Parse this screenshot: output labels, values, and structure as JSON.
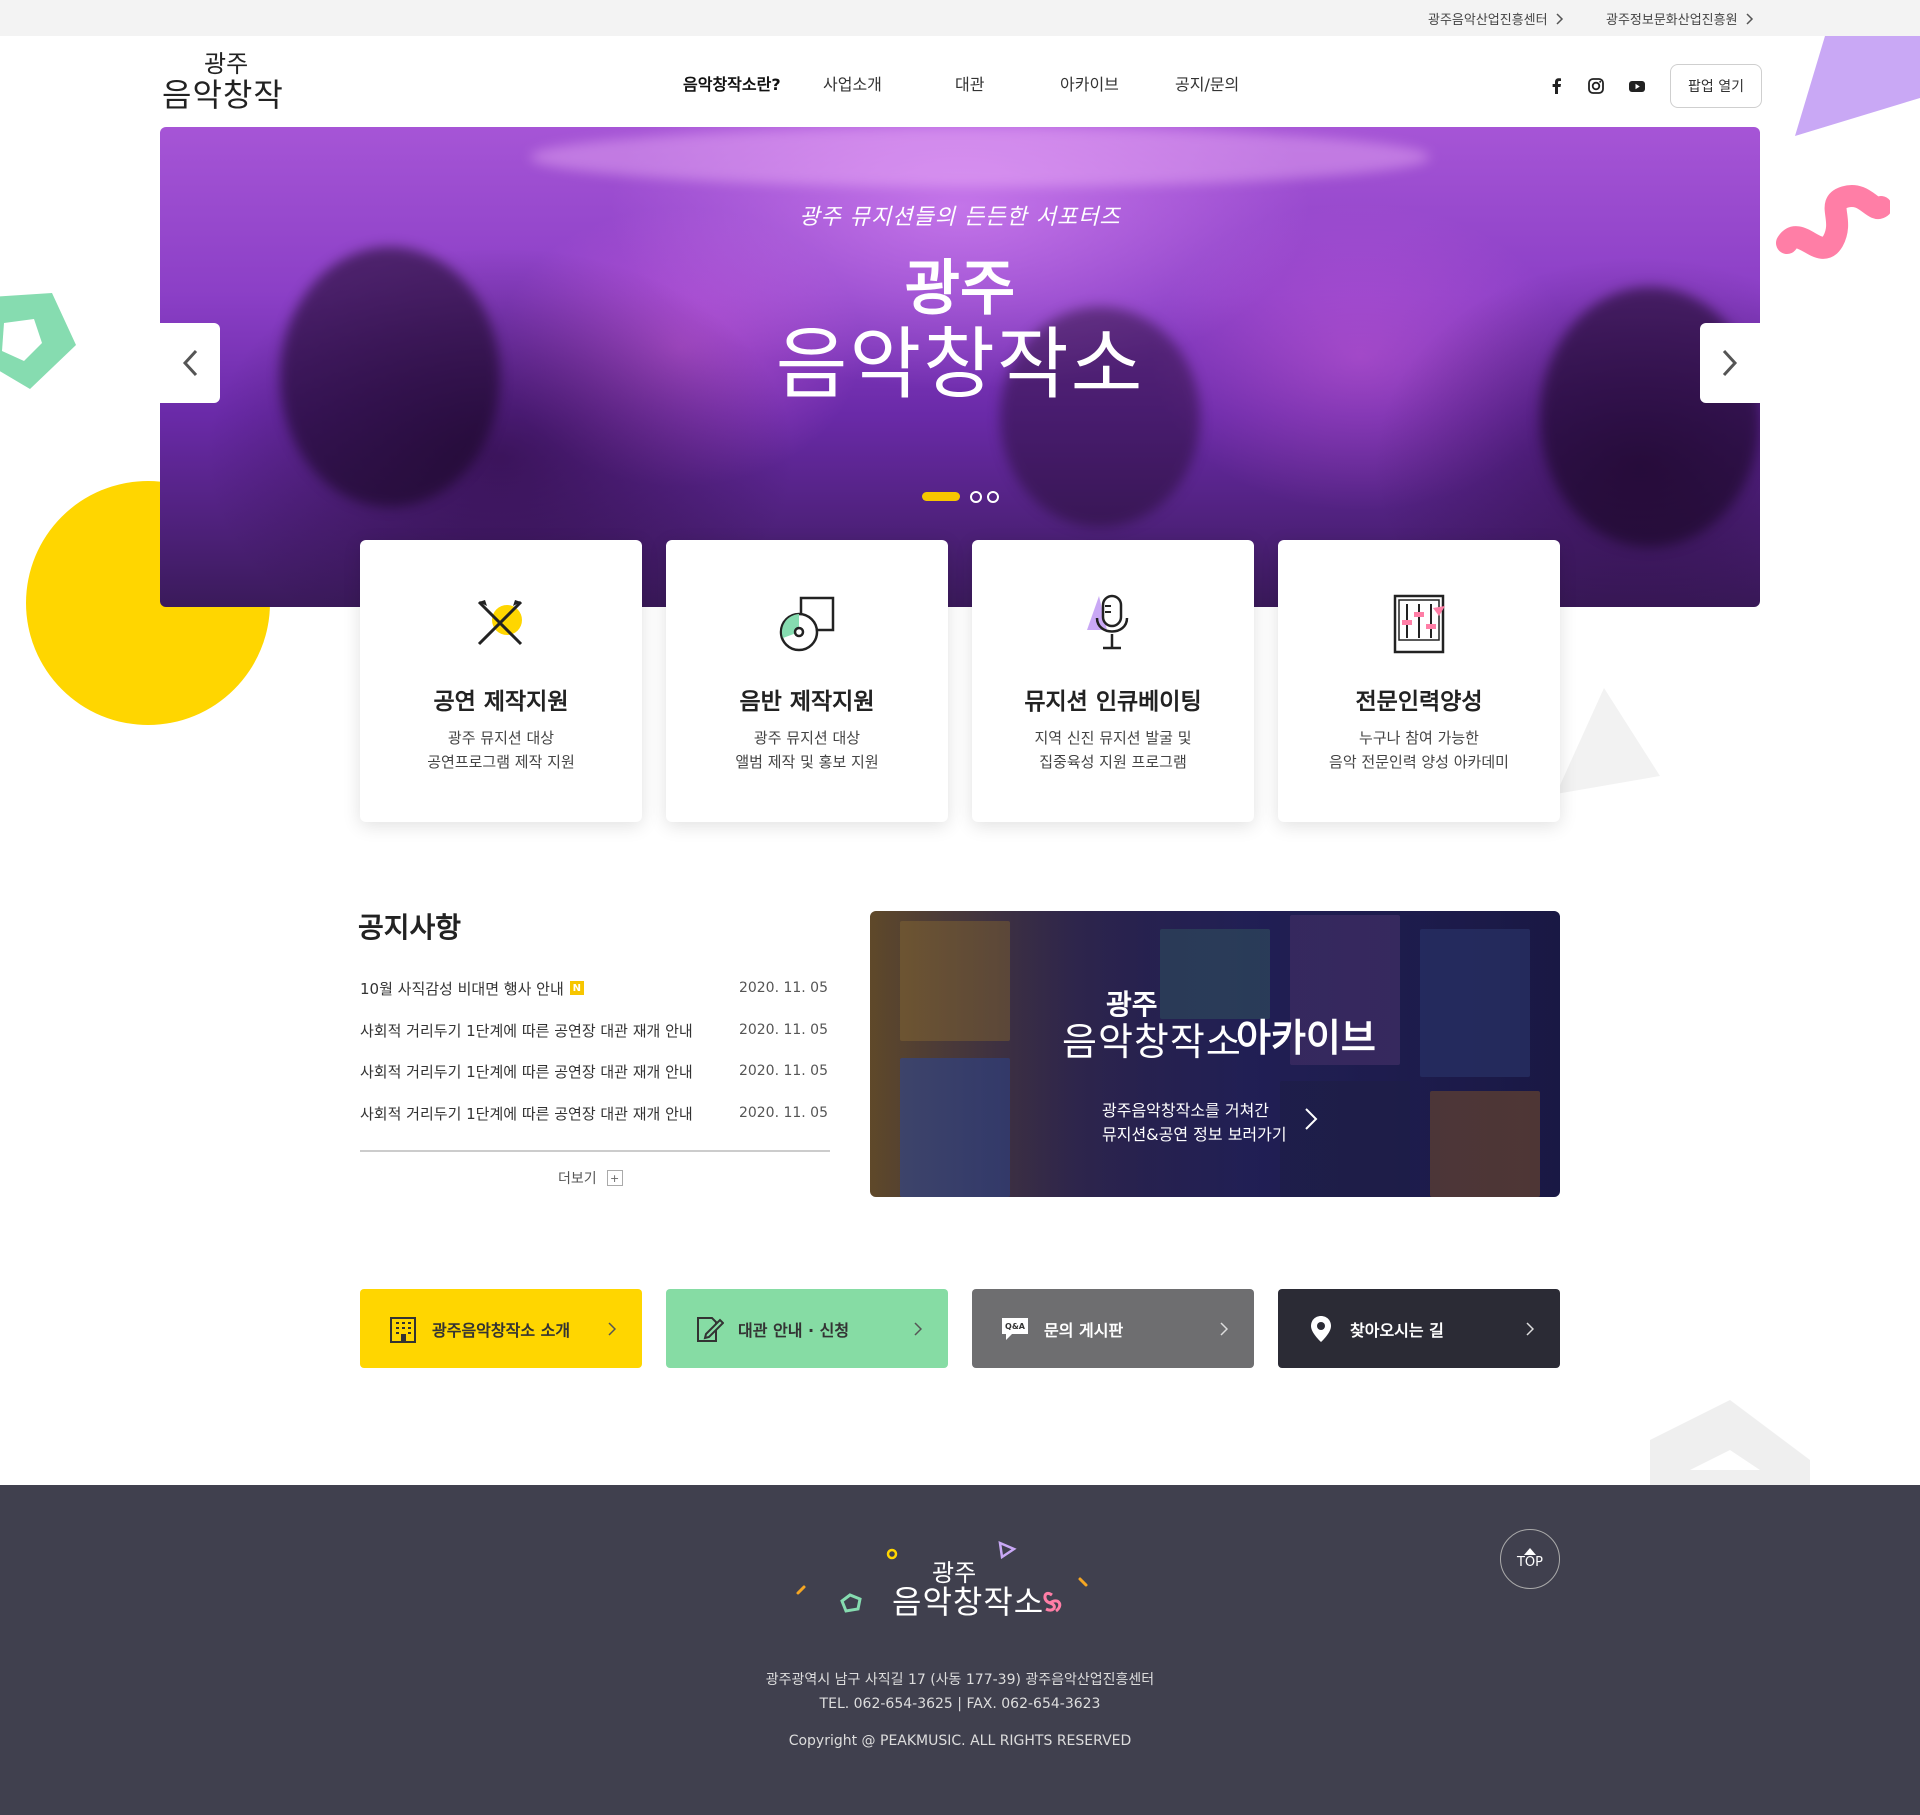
{
  "util_links": [
    "광주음악산업진흥센터",
    "광주정보문화산업진흥원"
  ],
  "logo": {
    "line1": "광주",
    "line2": "음악창작소"
  },
  "nav": [
    "음악창작소란?",
    "사업소개",
    "대관",
    "아카이브",
    "공지/문의"
  ],
  "social_icons": [
    "facebook-icon",
    "instagram-icon",
    "youtube-icon"
  ],
  "popup_button": "팝업 열기",
  "hero": {
    "subtitle": "광주 뮤지션들의 든든한 서포터즈",
    "title_line1": "광주",
    "title_line2": "음악창작소",
    "slide_index": 1,
    "slide_count": 3
  },
  "services": [
    {
      "title": "공연 제작지원",
      "desc1": "광주 뮤지션 대상",
      "desc2": "공연프로그램 제작 지원",
      "icon": "performance-icon"
    },
    {
      "title": "음반 제작지원",
      "desc1": "광주 뮤지션 대상",
      "desc2": "앨범 제작 및 홍보 지원",
      "icon": "album-icon"
    },
    {
      "title": "뮤지션 인큐베이팅",
      "desc1": "지역 신진 뮤지션 발굴 및",
      "desc2": "집중육성 지원 프로그램",
      "icon": "microphone-icon"
    },
    {
      "title": "전문인력양성",
      "desc1": "누구나 참여 가능한",
      "desc2": "음악 전문인력 양성 아카데미",
      "icon": "mixer-icon"
    }
  ],
  "notice": {
    "title": "공지사항",
    "items": [
      {
        "text": "10월 사직감성 비대면 행사 안내",
        "date": "2020. 11. 05",
        "new": "N"
      },
      {
        "text": "사회적 거리두기 1단계에 따른 공연장 대관 재개 안내",
        "date": "2020. 11. 05"
      },
      {
        "text": "사회적 거리두기 1단계에 따른 공연장 대관 재개 안내",
        "date": "2020. 11. 05"
      },
      {
        "text": "사회적 거리두기 1단계에 따른 공연장 대관 재개 안내",
        "date": "2020. 11. 05"
      }
    ],
    "more": "더보기",
    "more_icon": "+"
  },
  "archive": {
    "logo_line1": "광주",
    "logo_line2": "음악창작소",
    "title": "아카이브",
    "desc1": "광주음악창작소를 거쳐간",
    "desc2": "뮤지션&공연 정보 보러가기"
  },
  "quick_links": [
    {
      "label": "광주음악창작소 소개",
      "icon": "building-icon",
      "bg": "#FFD600",
      "fg": "#333333"
    },
    {
      "label": "대관 안내 · 신청",
      "icon": "edit-icon",
      "bg": "#86DCA4",
      "fg": "#333333"
    },
    {
      "label": "문의 게시판",
      "icon": "qna-icon",
      "bg": "#6E6E70",
      "fg": "#FFFFFF"
    },
    {
      "label": "찾아오시는 길",
      "icon": "location-pin-icon",
      "bg": "#2B2B35",
      "fg": "#FFFFFF"
    }
  ],
  "footer": {
    "logo_line1": "광주",
    "logo_line2": "음악창작소",
    "address": "광주광역시 남구 사직길 17 (사동 177-39) 광주음악산업진흥센터",
    "contact": "TEL. 062-654-3625  |  FAX. 062-654-3623",
    "copyright": "Copyright @ PEAKMUSIC. ALL RIGHTS RESERVED",
    "top_button": "TOP"
  },
  "colors": {
    "accent_yellow": "#FFD600",
    "accent_mint": "#86DCA4",
    "accent_purple": "#C9A8F5",
    "accent_pink": "#FF7EA6",
    "footer_bg": "#40404E"
  }
}
